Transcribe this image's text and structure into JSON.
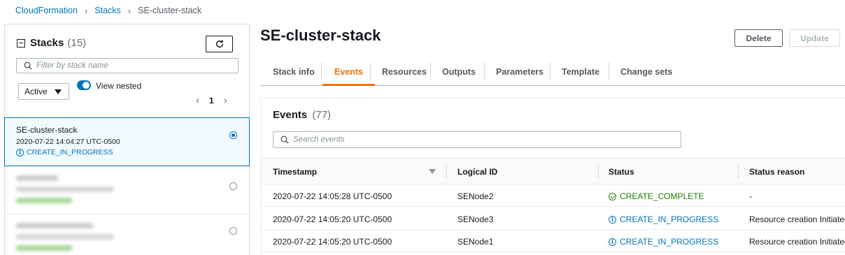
{
  "breadcrumb": {
    "root": "CloudFormation",
    "section": "Stacks",
    "current": "SE-cluster-stack"
  },
  "stacks_panel": {
    "title": "Stacks",
    "count": "(15)",
    "search_placeholder": "Filter by stack name",
    "filter_value": "Active",
    "view_nested_label": "View nested",
    "page": "1",
    "selected_stack": {
      "name": "SE-cluster-stack",
      "created": "2020-07-22 14:04:27 UTC-0500",
      "status": "CREATE_IN_PROGRESS"
    }
  },
  "stack_detail": {
    "title": "SE-cluster-stack",
    "delete_label": "Delete",
    "update_label": "Update",
    "tabs": [
      {
        "label": "Stack info"
      },
      {
        "label": "Events"
      },
      {
        "label": "Resources"
      },
      {
        "label": "Outputs"
      },
      {
        "label": "Parameters"
      },
      {
        "label": "Template"
      },
      {
        "label": "Change sets"
      }
    ],
    "active_tab": "Events"
  },
  "events": {
    "title": "Events",
    "count": "(77)",
    "search_placeholder": "Search events",
    "columns": {
      "timestamp": "Timestamp",
      "logical_id": "Logical ID",
      "status": "Status",
      "status_reason": "Status reason"
    },
    "rows": [
      {
        "timestamp": "2020-07-22 14:05:28 UTC-0500",
        "logical_id": "SENode2",
        "status": "CREATE_COMPLETE",
        "status_reason": "-"
      },
      {
        "timestamp": "2020-07-22 14:05:20 UTC-0500",
        "logical_id": "SENode3",
        "status": "CREATE_IN_PROGRESS",
        "status_reason": "Resource creation Initiated"
      },
      {
        "timestamp": "2020-07-22 14:05:20 UTC-0500",
        "logical_id": "SENode1",
        "status": "CREATE_IN_PROGRESS",
        "status_reason": "Resource creation Initiated"
      }
    ]
  },
  "colors": {
    "link": "#0073bb",
    "active_tab": "#ec7211",
    "success": "#1d8102"
  }
}
